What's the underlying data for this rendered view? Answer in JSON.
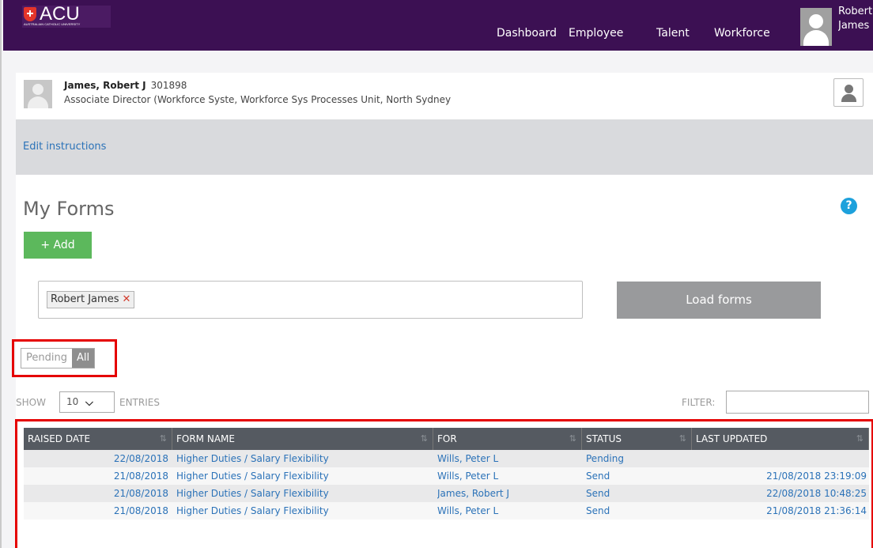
{
  "header": {
    "logo_text": "ACU",
    "logo_subtitle": "AUSTRALIAN CATHOLIC UNIVERSITY",
    "nav": [
      "Dashboard",
      "Employee",
      "Talent",
      "Workforce"
    ],
    "user_first": "Robert",
    "user_last": "James"
  },
  "employee": {
    "name": "James, Robert J",
    "id": "301898",
    "role": "Associate Director (Workforce Syste, Workforce Sys Processes Unit, North Sydney"
  },
  "instructions": {
    "edit_label": "Edit instructions"
  },
  "forms": {
    "title": "My Forms",
    "help_glyph": "?",
    "add_label": "+ Add",
    "tag": "Robert James",
    "tag_remove": "✕",
    "load_label": "Load forms",
    "toggle": {
      "pending": "Pending",
      "all": "All",
      "active": "All"
    },
    "show_label": "SHOW",
    "entries_value": "10",
    "entries_label": "ENTRIES",
    "filter_label": "FILTER:",
    "filter_value": ""
  },
  "table": {
    "columns": [
      "RAISED DATE",
      "FORM NAME",
      "FOR",
      "STATUS",
      "LAST UPDATED"
    ],
    "rows": [
      [
        "22/08/2018",
        "Higher Duties / Salary Flexibility",
        "Wills, Peter L",
        "Pending",
        ""
      ],
      [
        "21/08/2018",
        "Higher Duties / Salary Flexibility",
        "Wills, Peter L",
        "Send",
        "21/08/2018 23:19:09"
      ],
      [
        "21/08/2018",
        "Higher Duties / Salary Flexibility",
        "James, Robert J",
        "Send",
        "22/08/2018 10:48:25"
      ],
      [
        "21/08/2018",
        "Higher Duties / Salary Flexibility",
        "Wills, Peter L",
        "Send",
        "21/08/2018 21:36:14"
      ]
    ]
  },
  "colors": {
    "topbar": "#3c1053",
    "link": "#2b72b8",
    "add_button": "#5cb85c",
    "highlight": "#e50000",
    "table_header": "#555a61"
  },
  "icons": {
    "logo": "shield-cross-icon",
    "user": "user-avatar-icon",
    "profile": "person-icon",
    "help": "question-circle-icon",
    "remove": "close-icon",
    "select": "chevron-down-icon",
    "sort": "sort-icon"
  }
}
